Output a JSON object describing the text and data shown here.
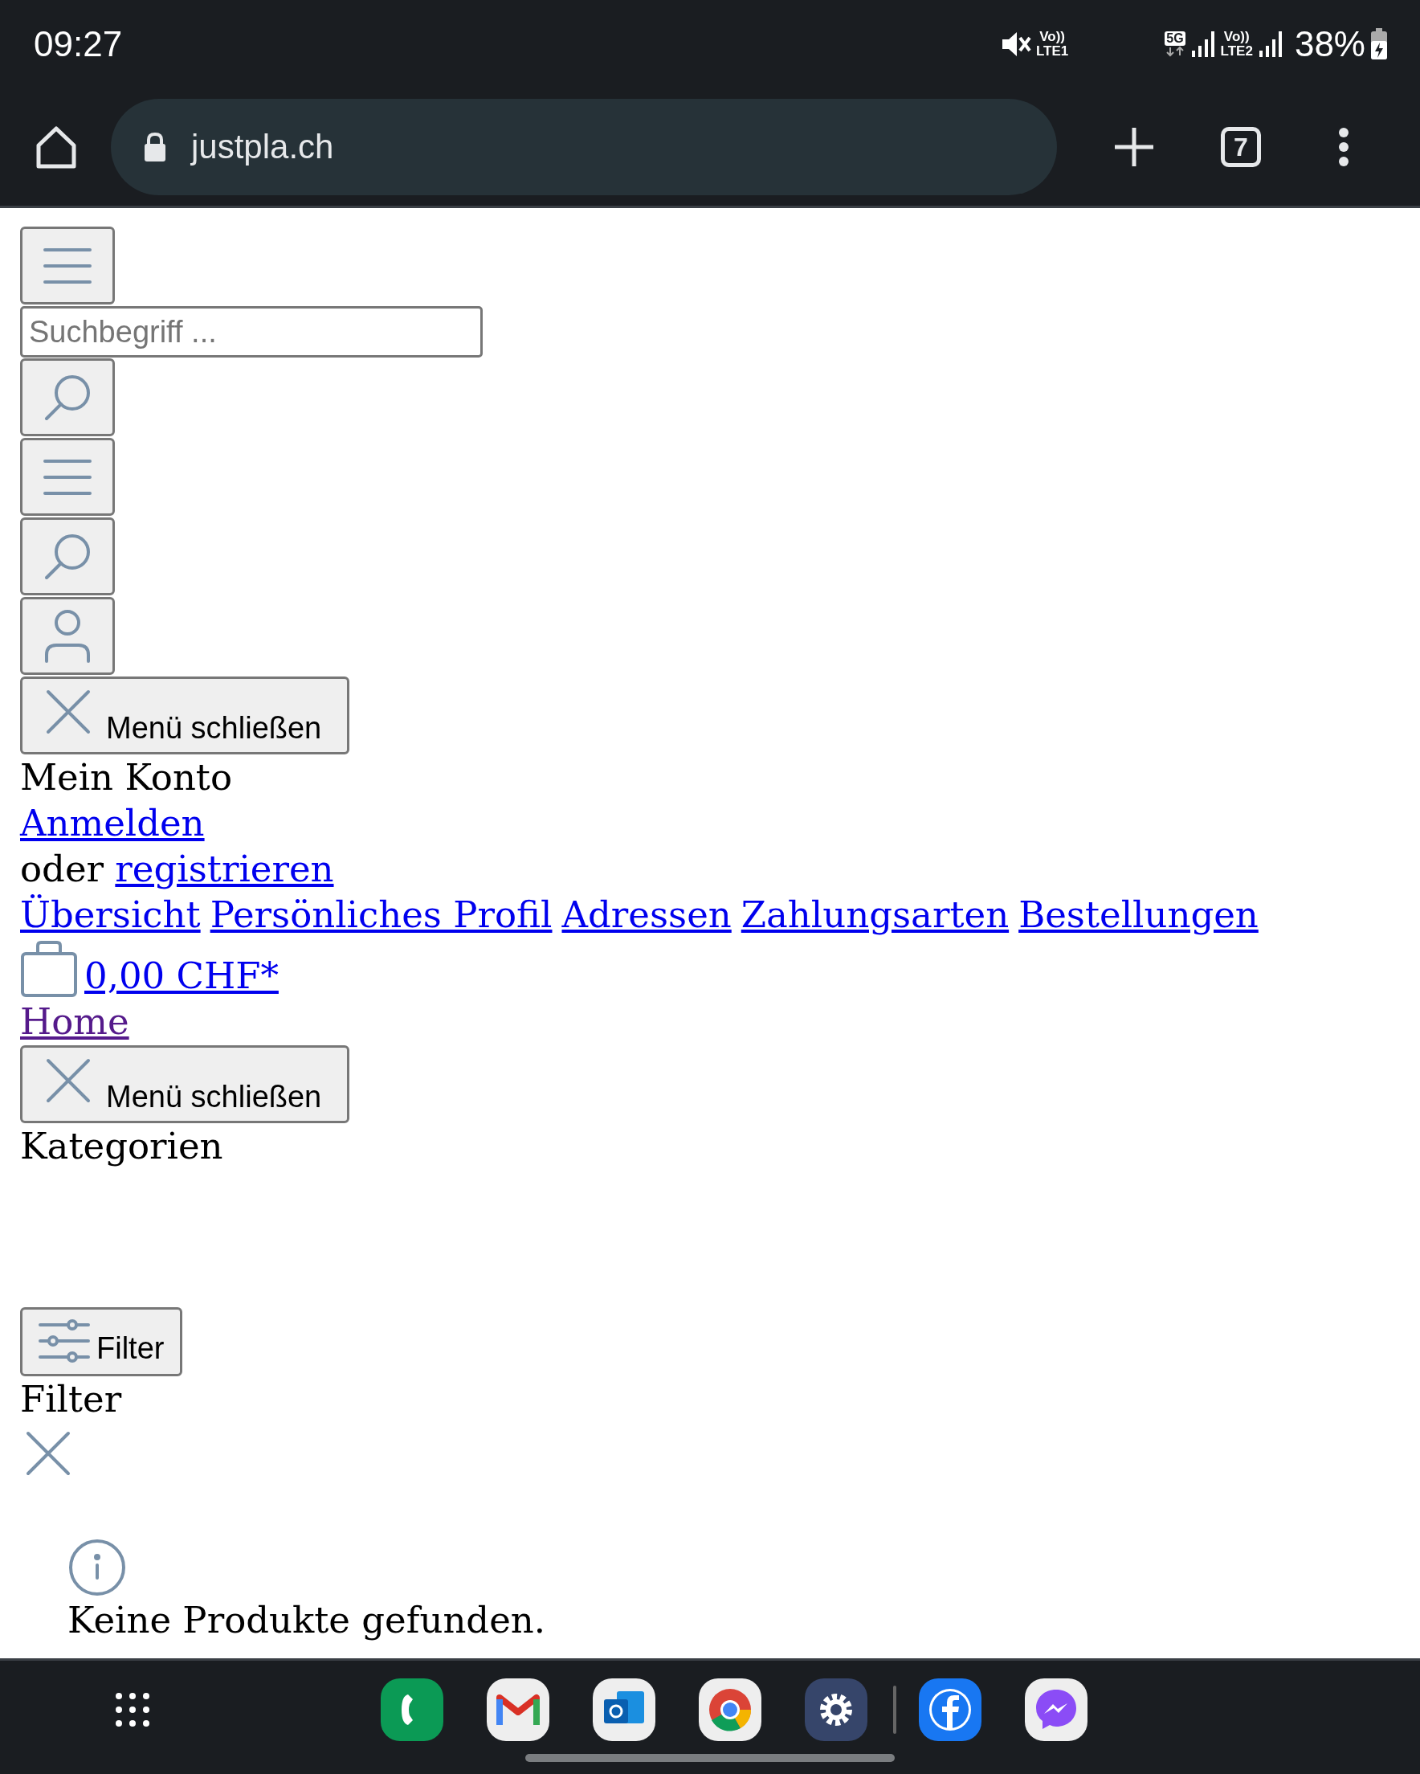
{
  "status_bar": {
    "time": "09:27",
    "network_1": {
      "voice": "Vo))",
      "label": "LTE1"
    },
    "network_2": {
      "badge": "5G",
      "voice": "Vo))",
      "label": "LTE2"
    },
    "battery": "38%"
  },
  "browser": {
    "url": "justpla.ch",
    "tab_count": "7"
  },
  "page": [
    {
      "kind": "menu_button"
    },
    {
      "kind": "search_field",
      "placeholder": "Suchbegriff ..."
    },
    {
      "kind": "search_button"
    },
    {
      "kind": "menu_button"
    },
    {
      "kind": "search_button"
    },
    {
      "kind": "account_button"
    },
    {
      "kind": "close_button",
      "label": "Menü schließen"
    },
    {
      "kind": "heading",
      "text": "Mein Konto"
    },
    {
      "kind": "link",
      "text": "Anmelden",
      "visited": false
    },
    {
      "kind": "text_link",
      "text": "oder",
      "link": "registrieren"
    },
    {
      "kind": "links",
      "links": [
        "Übersicht",
        "Persönliches Profil",
        "Adressen",
        "Zahlungsarten",
        "Bestellungen"
      ]
    },
    {
      "kind": "cart_link",
      "text": "0,00 CHF*"
    },
    {
      "kind": "link",
      "text": "Home",
      "visited": true
    },
    {
      "kind": "close_button",
      "label": "Menü schließen"
    },
    {
      "kind": "heading",
      "text": "Kategorien"
    },
    {
      "kind": "filter_button",
      "label": "Filter"
    },
    {
      "kind": "heading",
      "text": "Filter"
    },
    {
      "kind": "close_icon"
    },
    {
      "kind": "notice",
      "text": "Keine Produkte gefunden."
    }
  ]
}
